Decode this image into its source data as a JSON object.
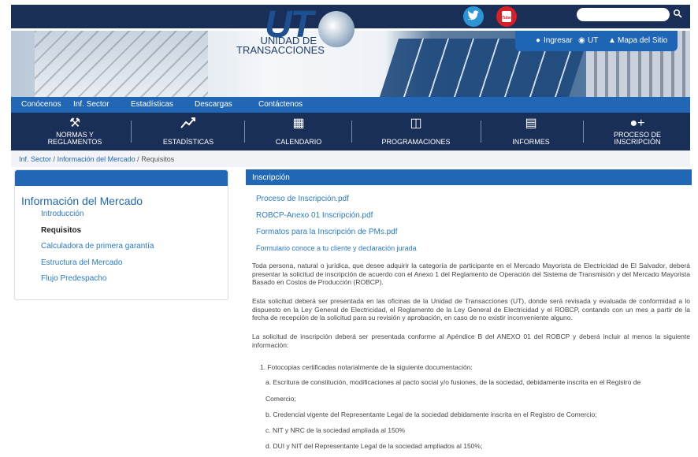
{
  "topbar": {
    "twitter_icon": "twitter-icon",
    "youtube_label": "You Tube",
    "search_placeholder": ""
  },
  "logo": {
    "ut": "UT",
    "line1": "UNIDAD DE",
    "line2": "TRANSACCIONES"
  },
  "util": {
    "login": "Ingresar",
    "ut": "UT",
    "sitemap": "Mapa del Sitio"
  },
  "mainnav": [
    "Conócenos",
    "Inf. Sector",
    "Estadísticas",
    "Descargas",
    "Contáctenos"
  ],
  "iconnav": [
    {
      "label1": "NORMAS Y",
      "label2": "REGLAMENTOS"
    },
    {
      "label1": "",
      "label2": "ESTADÍSTICAS"
    },
    {
      "label1": "",
      "label2": "CALENDARIO"
    },
    {
      "label1": "",
      "label2": "PROGRAMACIONES"
    },
    {
      "label1": "",
      "label2": "INFORMES"
    },
    {
      "label1": "PROCESO DE",
      "label2": "INSCRIPCIÓN"
    }
  ],
  "breadcrumb": {
    "a": "Inf. Sector",
    "b": "Información del Mercado",
    "c": "Requisitos",
    "sep": "/"
  },
  "sidebar": {
    "title": "Información del Mercado",
    "items": [
      "Introducción",
      "Requisitos",
      "Calculadora de primera garantía",
      "Estructura del Mercado",
      "Flujo Predespacho"
    ]
  },
  "content": {
    "heading": "Inscripción",
    "links": [
      "Proceso de Inscripción.pdf",
      "ROBCP-Anexo 01 Inscripción.pdf",
      "Formatos para la Inscripción de PMs.pdf",
      "Formulario conoce a tu cliente y declaración jurada"
    ],
    "p1": "Toda persona, natural o jurídica, que desee adquirir la categoría de participante en el Mercado Mayorista de Electricidad de El Salvador, deberá presentar la solicitud de inscripción de acuerdo con el  Anexo 1 del Reglamento de Operación del Sistema de Transmisión y del Mercado Mayorista Basado en Costos de Producción (ROBCP).",
    "p2": "Esta solicitud deberá ser presentada en las oficinas de la Unidad de Transacciones (UT), donde será revisada y evaluada de conformidad a lo dispuesto en la Ley General de Electricidad, el Reglamento de la Ley General de Electricidad y el ROBCP, contando con un mes a partir de la fecha de recepción de la solicitud para su revisión y aprobación, en caso de no existir inconveniente alguno.",
    "p3": " La solicitud de inscripción deberá ser presentada conforme al Apéndice B del ANEXO 01 del ROBCP y deberá incluir al menos la siguiente información:",
    "item1": "1. Fotocopias certificadas notarialmente de la siguiente documentación:",
    "sub_a1": "a. Escritura de constitución, modificaciones al pacto social y/o fusiones, de la sociedad, debidamente inscrita en el Registro de",
    "sub_a2": "Comercio;",
    "sub_b": "b. Credencial vigente del Representante Legal de la sociedad debidamente inscrita en el Registro de Comercio;",
    "sub_c": "c. NIT y NRC de la sociedad ampliada al 150%",
    "sub_d": "d. DUI y NIT del Representante Legal de la sociedad ampliados al 150%;"
  }
}
